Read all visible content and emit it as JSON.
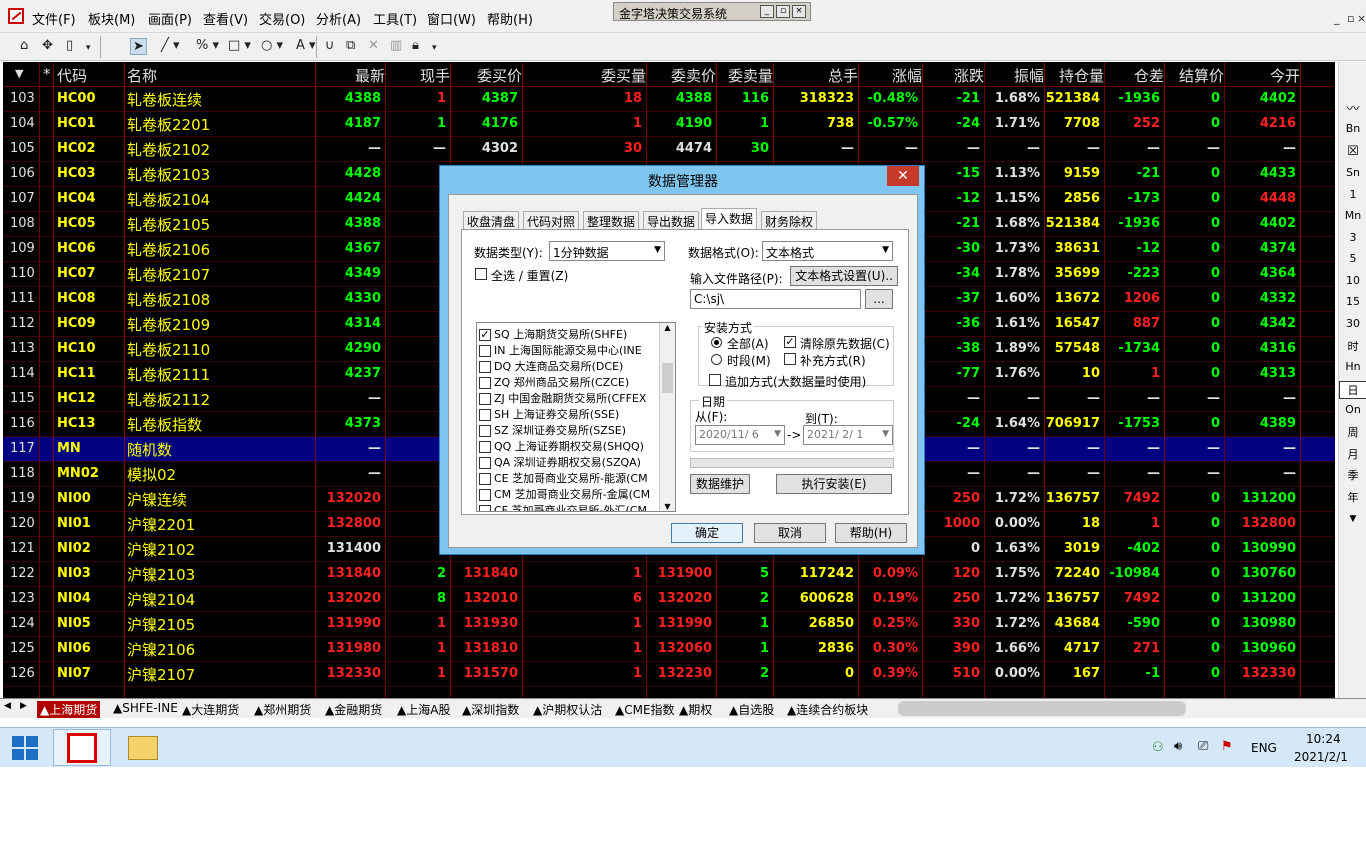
{
  "menubar": {
    "items": [
      "文件(F)",
      "板块(M)",
      "画面(P)",
      "查看(V)",
      "交易(O)",
      "分析(A)",
      "工具(T)",
      "窗口(W)",
      "帮助(H)"
    ],
    "floating_title": "金字塔决策交易系统"
  },
  "header": [
    "*",
    "代码",
    "名称",
    "最新",
    "现手",
    "委买价",
    "委买量",
    "委卖价",
    "委卖量",
    "总手",
    "涨幅",
    "涨跌",
    "振幅",
    "持仓量",
    "仓差",
    "结算价",
    "今开"
  ],
  "rows": [
    {
      "n": "103",
      "code": "HC00",
      "name": "轧卷板连续",
      "last": "4388",
      "vol": "1",
      "bid": "4387",
      "bidq": "18",
      "ask": "4388",
      "askq": "116",
      "total": "318323",
      "pct": "-0.48%",
      "chg": "-21",
      "amp": "1.68%",
      "oi": "521384",
      "oid": "-1936",
      "settle": "0",
      "open": "4402"
    },
    {
      "n": "104",
      "code": "HC01",
      "name": "轧卷板2201",
      "last": "4187",
      "vol": "1",
      "bid": "4176",
      "bidq": "1",
      "ask": "4190",
      "askq": "1",
      "total": "738",
      "pct": "-0.57%",
      "chg": "-24",
      "amp": "1.71%",
      "oi": "7708",
      "oid": "252",
      "settle": "0",
      "open": "4216"
    },
    {
      "n": "105",
      "code": "HC02",
      "name": "轧卷板2102",
      "last": "—",
      "vol": "—",
      "bid": "4302",
      "bidq": "30",
      "ask": "4474",
      "askq": "30",
      "total": "—",
      "pct": "—",
      "chg": "—",
      "amp": "—",
      "oi": "—",
      "oid": "—",
      "settle": "—",
      "open": "—"
    },
    {
      "n": "106",
      "code": "HC03",
      "name": "轧卷板2103",
      "last": "4428",
      "chg": "-15",
      "amp": "1.13%",
      "oi": "9159",
      "oid": "-21",
      "settle": "0",
      "open": "4433"
    },
    {
      "n": "107",
      "code": "HC04",
      "name": "轧卷板2104",
      "last": "4424",
      "chg": "-12",
      "amp": "1.15%",
      "oi": "2856",
      "oid": "-173",
      "settle": "0",
      "open": "4448"
    },
    {
      "n": "108",
      "code": "HC05",
      "name": "轧卷板2105",
      "last": "4388",
      "chg": "-21",
      "amp": "1.68%",
      "oi": "521384",
      "oid": "-1936",
      "settle": "0",
      "open": "4402"
    },
    {
      "n": "109",
      "code": "HC06",
      "name": "轧卷板2106",
      "last": "4367",
      "chg": "-30",
      "amp": "1.73%",
      "oi": "38631",
      "oid": "-12",
      "settle": "0",
      "open": "4374"
    },
    {
      "n": "110",
      "code": "HC07",
      "name": "轧卷板2107",
      "last": "4349",
      "chg": "-34",
      "amp": "1.78%",
      "oi": "35699",
      "oid": "-223",
      "settle": "0",
      "open": "4364"
    },
    {
      "n": "111",
      "code": "HC08",
      "name": "轧卷板2108",
      "last": "4330",
      "chg": "-37",
      "amp": "1.60%",
      "oi": "13672",
      "oid": "1206",
      "settle": "0",
      "open": "4332"
    },
    {
      "n": "112",
      "code": "HC09",
      "name": "轧卷板2109",
      "last": "4314",
      "chg": "-36",
      "amp": "1.61%",
      "oi": "16547",
      "oid": "887",
      "settle": "0",
      "open": "4342"
    },
    {
      "n": "113",
      "code": "HC10",
      "name": "轧卷板2110",
      "last": "4290",
      "chg": "-38",
      "amp": "1.89%",
      "oi": "57548",
      "oid": "-1734",
      "settle": "0",
      "open": "4316"
    },
    {
      "n": "114",
      "code": "HC11",
      "name": "轧卷板2111",
      "last": "4237",
      "chg": "-77",
      "amp": "1.76%",
      "oi": "10",
      "oid": "1",
      "settle": "0",
      "open": "4313"
    },
    {
      "n": "115",
      "code": "HC12",
      "name": "轧卷板2112",
      "last": "—",
      "chg": "—",
      "amp": "—",
      "oi": "—",
      "oid": "—",
      "settle": "—",
      "open": "—"
    },
    {
      "n": "116",
      "code": "HC13",
      "name": "轧卷板指数",
      "last": "4373",
      "chg": "-24",
      "amp": "1.64%",
      "oi": "706917",
      "oid": "-1753",
      "settle": "0",
      "open": "4389"
    },
    {
      "n": "117",
      "code": "MN",
      "name": "随机数",
      "last": "—",
      "chg": "—",
      "amp": "—",
      "oi": "—",
      "oid": "—",
      "settle": "—",
      "open": "—"
    },
    {
      "n": "118",
      "code": "MN02",
      "name": "模拟02",
      "last": "—",
      "chg": "—",
      "amp": "—",
      "oi": "—",
      "oid": "—",
      "settle": "—",
      "open": "—"
    },
    {
      "n": "119",
      "code": "NI00",
      "name": "沪镍连续",
      "last": "132020",
      "chg": "250",
      "amp": "1.72%",
      "oi": "136757",
      "oid": "7492",
      "settle": "0",
      "open": "131200"
    },
    {
      "n": "120",
      "code": "NI01",
      "name": "沪镍2201",
      "last": "132800",
      "chg": "1000",
      "amp": "0.00%",
      "oi": "18",
      "oid": "1",
      "settle": "0",
      "open": "132800"
    },
    {
      "n": "121",
      "code": "NI02",
      "name": "沪镍2102",
      "last": "131400",
      "chg": "0",
      "amp": "1.63%",
      "oi": "3019",
      "oid": "-402",
      "settle": "0",
      "open": "130990"
    },
    {
      "n": "122",
      "code": "NI03",
      "name": "沪镍2103",
      "last": "131840",
      "vol": "2",
      "bid": "131840",
      "bidq": "1",
      "ask": "131900",
      "askq": "5",
      "total": "117242",
      "pct": "0.09%",
      "chg": "120",
      "amp": "1.75%",
      "oi": "72240",
      "oid": "-10984",
      "settle": "0",
      "open": "130760"
    },
    {
      "n": "123",
      "code": "NI04",
      "name": "沪镍2104",
      "last": "132020",
      "vol": "8",
      "bid": "132010",
      "bidq": "6",
      "ask": "132020",
      "askq": "2",
      "total": "600628",
      "pct": "0.19%",
      "chg": "250",
      "amp": "1.72%",
      "oi": "136757",
      "oid": "7492",
      "settle": "0",
      "open": "131200"
    },
    {
      "n": "124",
      "code": "NI05",
      "name": "沪镍2105",
      "last": "131990",
      "vol": "1",
      "bid": "131930",
      "bidq": "1",
      "ask": "131990",
      "askq": "1",
      "total": "26850",
      "pct": "0.25%",
      "chg": "330",
      "amp": "1.72%",
      "oi": "43684",
      "oid": "-590",
      "settle": "0",
      "open": "130980"
    },
    {
      "n": "125",
      "code": "NI06",
      "name": "沪镍2106",
      "last": "131980",
      "vol": "1",
      "bid": "131810",
      "bidq": "1",
      "ask": "132060",
      "askq": "1",
      "total": "2836",
      "pct": "0.30%",
      "chg": "390",
      "amp": "1.66%",
      "oi": "4717",
      "oid": "271",
      "settle": "0",
      "open": "130960"
    },
    {
      "n": "126",
      "code": "NI07",
      "name": "沪镍2107",
      "last": "132330",
      "vol": "1",
      "bid": "131570",
      "bidq": "1",
      "ask": "132230",
      "askq": "2",
      "total": "0",
      "pct": "0.39%",
      "chg": "510",
      "amp": "0.00%",
      "oi": "167",
      "oid": "-1",
      "settle": "0",
      "open": "132330"
    }
  ],
  "right_panel": [
    "Sn",
    "1",
    "Mn",
    "3",
    "5",
    "10",
    "15",
    "30",
    "时",
    "Hn",
    "日",
    "On",
    "周",
    "月",
    "季",
    "年"
  ],
  "tabs": [
    "▲上海期货",
    "▲SHFE-INE",
    "▲大连期货",
    "▲郑州期货",
    "▲金融期货",
    "▲上海A股",
    "▲深圳指数",
    "▲沪期权认沽",
    "▲CME指数",
    "▲期权",
    "▲自选股",
    "▲连续合约板块"
  ],
  "taskbar": {
    "lang": "ENG",
    "time": "10:24",
    "date": "2021/2/1"
  },
  "dialog": {
    "title": "数据管理器",
    "tabs": [
      "收盘清盘",
      "代码对照",
      "整理数据",
      "导出数据",
      "导入数据",
      "财务除权"
    ],
    "data_type_label": "数据类型(Y):",
    "data_type_value": "1分钟数据",
    "select_all_label": "全选 / 重置(Z)",
    "data_format_label": "数据格式(O):",
    "data_format_value": "文本格式",
    "path_label": "输入文件路径(P):",
    "format_settings_btn": "文本格式设置(U)..",
    "path_value": "C:\\sj\\",
    "browse_btn": "...",
    "install_group": "安装方式",
    "opt_all": "全部(A)",
    "opt_clear": "清除原先数据(C)",
    "opt_period": "时段(M)",
    "opt_fill": "补充方式(R)",
    "opt_append": "追加方式(大数据量时使用)",
    "date_group": "日期",
    "from_label": "从(F):",
    "to_label": "到(T):",
    "from_value": "2020/11/ 6",
    "to_value": "2021/ 2/ 1",
    "maintain_btn": "数据维护",
    "execute_btn": "执行安装(E)",
    "ok_btn": "确定",
    "cancel_btn": "取消",
    "help_btn": "帮助(H)",
    "exchanges": [
      {
        "label": "SQ 上海期货交易所(SHFE)",
        "checked": true
      },
      {
        "label": "IN 上海国际能源交易中心(INE",
        "checked": false
      },
      {
        "label": "DQ 大连商品交易所(DCE)",
        "checked": false
      },
      {
        "label": "ZQ 郑州商品交易所(CZCE)",
        "checked": false
      },
      {
        "label": "ZJ 中国金融期货交易所(CFFEX",
        "checked": false
      },
      {
        "label": "SH 上海证券交易所(SSE)",
        "checked": false
      },
      {
        "label": "SZ 深圳证券交易所(SZSE)",
        "checked": false
      },
      {
        "label": "QQ 上海证券期权交易(SHQQ)",
        "checked": false
      },
      {
        "label": "QA 深圳证券期权交易(SZQA)",
        "checked": false
      },
      {
        "label": "CE 芝加哥商业交易所-能源(CM",
        "checked": false
      },
      {
        "label": "CM 芝加哥商业交易所-金属(CM",
        "checked": false
      },
      {
        "label": "CF 芝加哥商业交易所-外汇(CM",
        "checked": false
      }
    ]
  }
}
